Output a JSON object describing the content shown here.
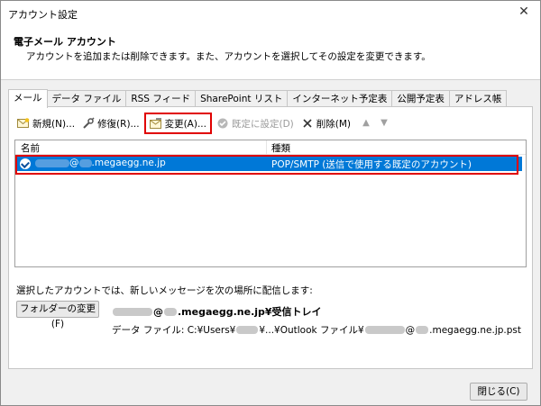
{
  "window": {
    "title": "アカウント設定",
    "close_icon": "close-icon"
  },
  "header": {
    "title": "電子メール アカウント",
    "description": "アカウントを追加または削除できます。また、アカウントを選択してその設定を変更できます。"
  },
  "tabs": [
    {
      "label": "メール",
      "active": true
    },
    {
      "label": "データ ファイル",
      "active": false
    },
    {
      "label": "RSS フィード",
      "active": false
    },
    {
      "label": "SharePoint リスト",
      "active": false
    },
    {
      "label": "インターネット予定表",
      "active": false
    },
    {
      "label": "公開予定表",
      "active": false
    },
    {
      "label": "アドレス帳",
      "active": false
    }
  ],
  "toolbar": {
    "new_label": "新規(N)...",
    "repair_label": "修復(R)...",
    "change_label": "変更(A)...",
    "default_label": "既定に設定(D)",
    "delete_label": "削除(M)",
    "up_icon": "arrow-up-icon",
    "down_icon": "arrow-down-icon"
  },
  "list": {
    "columns": [
      "名前",
      "種類"
    ],
    "rows": [
      {
        "name_suffix": "@",
        "name_domain": ".megaegg.ne.jp",
        "type": "POP/SMTP (送信で使用する既定のアカウント)",
        "selected": true
      }
    ]
  },
  "delivery": {
    "label": "選択したアカウントでは、新しいメッセージを次の場所に配信します:",
    "folder_button": "フォルダーの変更(F)",
    "at": "@",
    "path_suffix": ".megaegg.ne.jp¥受信トレイ",
    "data_file_prefix": "データ ファイル: C:¥Users¥",
    "data_file_mid": "¥...¥Outlook ファイル¥",
    "data_file_at": "@",
    "data_file_suffix": ".megaegg.ne.jp.pst"
  },
  "footer": {
    "close_label": "閉じる(C)"
  },
  "colors": {
    "selection": "#0078d7",
    "highlight": "#e00000"
  }
}
